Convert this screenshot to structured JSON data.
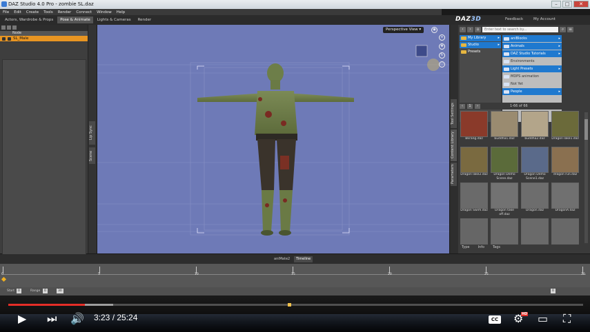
{
  "window": {
    "title": "DAZ Studio 4.0 Pro - zombie SL.daz",
    "buttons": [
      "–",
      "□",
      "✕"
    ]
  },
  "menu": [
    "File",
    "Edit",
    "Create",
    "Tools",
    "Render",
    "Connect",
    "Window",
    "Help"
  ],
  "main_tabs": [
    {
      "label": "Actors, Wardrobe & Props",
      "active": false
    },
    {
      "label": "Pose & Animate",
      "active": true
    },
    {
      "label": "Lights & Cameras",
      "active": false
    },
    {
      "label": "Render",
      "active": false
    }
  ],
  "header": {
    "logo_main": "DAZ",
    "logo_accent": "3D",
    "feedback": "Feedback",
    "account": "My Account"
  },
  "scene": {
    "column_header": "Node",
    "selected_node": "SL_Male"
  },
  "side_tabs": [
    "Lip Sync",
    "Scene"
  ],
  "viewport": {
    "view_label": "Perspective View",
    "background": "#6e7ab7"
  },
  "right_panel": {
    "vertical_tabs": [
      "Tool Settings",
      "Content Library",
      "Parameters"
    ],
    "search_placeholder": "Enter text to search by...",
    "library_left": [
      {
        "label": "My Library",
        "selected": true
      },
      {
        "label": "Studio",
        "selected": true
      },
      {
        "label": "Presets",
        "selected": false
      }
    ],
    "library_right": [
      {
        "label": "aniBlocks",
        "selected": true
      },
      {
        "label": "Animals",
        "selected": true
      },
      {
        "label": "DAZ Studio Tutorials",
        "selected": true
      },
      {
        "label": "Environments",
        "selected": false
      },
      {
        "label": "Light Presets",
        "selected": true
      },
      {
        "label": "MDPS animation",
        "selected": false
      },
      {
        "label": "Not Yet",
        "selected": false
      },
      {
        "label": "People",
        "selected": true
      }
    ],
    "pager": {
      "page": "1",
      "count": "1-66 of 66"
    },
    "thumbnails": [
      {
        "caption": "Bkrang.daz",
        "color": "#8a3a2a"
      },
      {
        "caption": "buddha1.daz",
        "color": "#9a8b70"
      },
      {
        "caption": "buddha2.daz",
        "color": "#b3a58a"
      },
      {
        "caption": "Dragon lake1.daz",
        "color": "#6b6a3a"
      },
      {
        "caption": "Dragon lake2.daz",
        "color": "#7a6a40"
      },
      {
        "caption": "Dragon Demo Scene.daz",
        "color": "#5b6b3a"
      },
      {
        "caption": "Dragon Demo Scene1.daz",
        "color": "#5a6a8a"
      },
      {
        "caption": "dragon run.daz",
        "color": "#8a7050"
      },
      {
        "caption": "Dragon Swim.daz",
        "color": "#6a6a6a"
      },
      {
        "caption": "Dragon take off.daz",
        "color": "#727272"
      },
      {
        "caption": "Dragon.daz",
        "color": "#6d6d6d"
      },
      {
        "caption": "DragonA.daz",
        "color": "#707070"
      },
      {
        "caption": "",
        "color": "#666666"
      },
      {
        "caption": "",
        "color": "#696969"
      },
      {
        "caption": "",
        "color": "#6a6a6a"
      },
      {
        "caption": "",
        "color": "#686868"
      }
    ],
    "bottom_tabs": [
      {
        "label": "Type",
        "on": true
      },
      {
        "label": "Info",
        "on": false
      },
      {
        "label": "Tags",
        "on": false
      }
    ]
  },
  "timeline": {
    "tabs": [
      {
        "label": "aniMate2",
        "on": false
      },
      {
        "label": "Timeline",
        "on": true
      }
    ],
    "ticks": [
      "0",
      "5",
      "10",
      "15",
      "20",
      "25",
      "30"
    ],
    "controls": {
      "start_label": "Start",
      "start_value": "0",
      "range_label": "Range",
      "range_a": "0",
      "range_b": "30",
      "current_value": "0"
    }
  },
  "youtube": {
    "current_time": "3:23",
    "total_time": "25:24",
    "played_fraction": 0.133,
    "buffered_fraction": 0.183,
    "hd_badge": "HD",
    "cc_label": "CC"
  }
}
